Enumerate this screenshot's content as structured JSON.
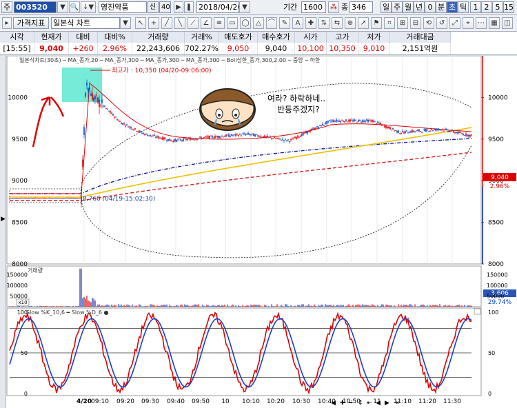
{
  "toolbar": {
    "market_label": "주",
    "code": "003520",
    "stock_name": "영진약품",
    "credit_badge": "신",
    "market_badge": "40",
    "date": "2018/04/20",
    "period_label": "기간",
    "period_value": "1600",
    "count_label": "종",
    "count_value": "346",
    "timeframes": [
      "일",
      "주",
      "월",
      "년",
      "0",
      "분",
      "초",
      "틱",
      "1",
      "2",
      "5",
      "15"
    ]
  },
  "toolbar2": {
    "indicator_button": "가격지표",
    "chart_type": "일본식 차트"
  },
  "quote": {
    "headers": [
      "시각",
      "현재가",
      "대비",
      "대비%",
      "거래량",
      "거래%",
      "매도호가",
      "매수호가",
      "시가",
      "고가",
      "저가",
      "거래대금"
    ],
    "values": [
      "[15:55]",
      "9,040",
      "+260",
      "2.96%",
      "22,243,606",
      "702.27%",
      "9,050",
      "9,040",
      "10,100",
      "10,350",
      "9,010",
      "2,151억원"
    ]
  },
  "main_chart": {
    "legend": [
      "일본식차트(30초)",
      "MA_종가,20",
      "MA_종가,300",
      "MA_종가,300",
      "MA_종가,300",
      "Boll상한_종가,300,2.00",
      "중앙",
      "하한"
    ],
    "y_ticks": [
      "10000",
      "9500",
      "9000",
      "8500",
      "8000"
    ],
    "high_label": "최고가 : 10,350 (04/20-09:06:00)",
    "low_label": "8,760 (04/19-15:02:30)",
    "speech": [
      "여라? 하락하네..",
      "반등주겠지?"
    ],
    "price_tag": "9,040",
    "pct_tag": "2.96%"
  },
  "volume_chart": {
    "title": "거래량",
    "y_ticks": [
      "150000",
      "100000",
      "50000"
    ],
    "unit_tag": "x10",
    "value_tag": "3,606",
    "pct_tag": "29.74%"
  },
  "stoch_chart": {
    "legend": [
      "Slow %K_10,6",
      "Slow %D_6"
    ],
    "y_ticks": [
      "100",
      "50",
      "0"
    ]
  },
  "x_axis": [
    "4/20",
    "09:10",
    "09:20",
    "09:30",
    "09:40",
    "09:50",
    "10",
    "10:10",
    "10:20",
    "10:30",
    "10:40",
    "10:50",
    "11",
    "11:10",
    "11:20",
    "11:30"
  ],
  "colors": {
    "up": "#e00000",
    "down": "#0044cc",
    "ma20": "#e00000",
    "ma300a": "#1a1a9e",
    "ma300b": "#f0c000",
    "ma300c": "#cc2020",
    "highlight": "#5ee8d0"
  }
}
